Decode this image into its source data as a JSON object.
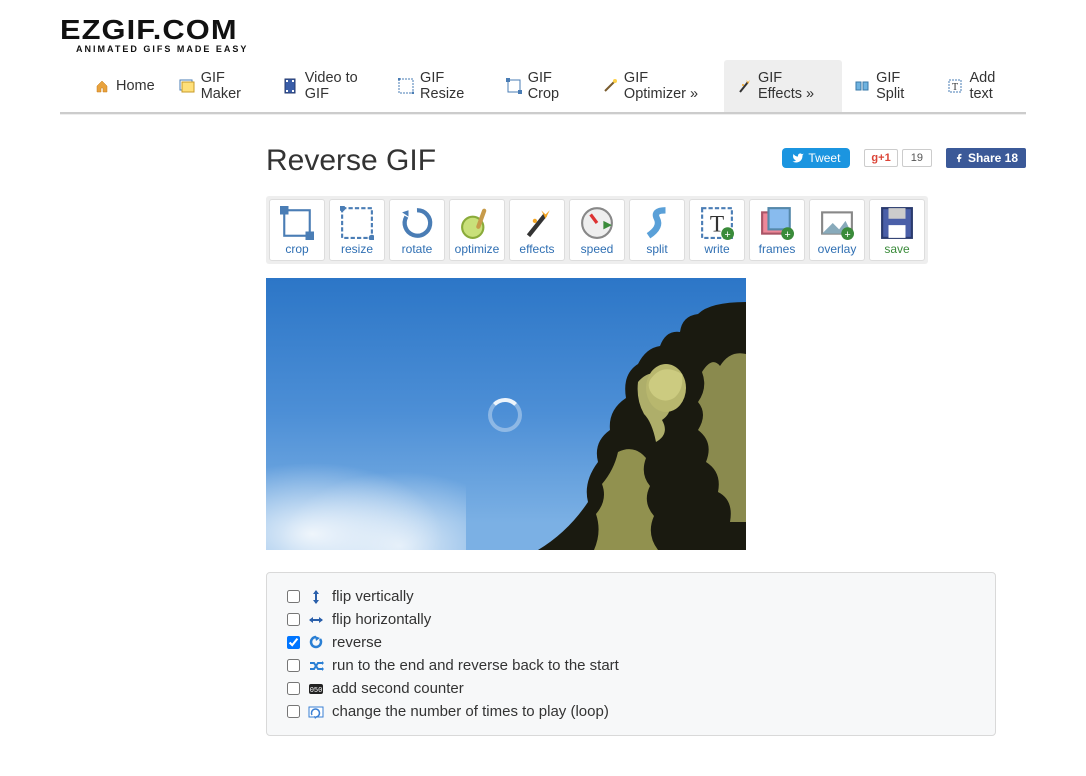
{
  "logo": {
    "main": "EZGIF.COM",
    "sub": "ANIMATED GIFS MADE EASY"
  },
  "nav": [
    {
      "label": "Home",
      "icon": "home"
    },
    {
      "label": "GIF Maker",
      "icon": "frames"
    },
    {
      "label": "Video to GIF",
      "icon": "film"
    },
    {
      "label": "GIF Resize",
      "icon": "resize"
    },
    {
      "label": "GIF Crop",
      "icon": "crop"
    },
    {
      "label": "GIF Optimizer »",
      "icon": "wand"
    },
    {
      "label": "GIF Effects »",
      "icon": "effects",
      "active": true
    },
    {
      "label": "GIF Split",
      "icon": "split"
    },
    {
      "label": "Add text",
      "icon": "text"
    }
  ],
  "title": "Reverse GIF",
  "social": {
    "tweet": "Tweet",
    "gplus": "+1",
    "gplus_count": "19",
    "fb": "Share 18"
  },
  "tools": [
    {
      "label": "crop",
      "icon": "crop"
    },
    {
      "label": "resize",
      "icon": "resize"
    },
    {
      "label": "rotate",
      "icon": "rotate"
    },
    {
      "label": "optimize",
      "icon": "optimize"
    },
    {
      "label": "effects",
      "icon": "effects"
    },
    {
      "label": "speed",
      "icon": "speed"
    },
    {
      "label": "split",
      "icon": "split"
    },
    {
      "label": "write",
      "icon": "write"
    },
    {
      "label": "frames",
      "icon": "frames"
    },
    {
      "label": "overlay",
      "icon": "overlay"
    },
    {
      "label": "save",
      "icon": "save",
      "cls": "save"
    }
  ],
  "options": [
    {
      "label": "flip vertically",
      "checked": false,
      "icon": "flipv"
    },
    {
      "label": "flip horizontally",
      "checked": false,
      "icon": "fliph"
    },
    {
      "label": "reverse",
      "checked": true,
      "icon": "reverse"
    },
    {
      "label": "run to the end and reverse back to the start",
      "checked": false,
      "icon": "shuffle"
    },
    {
      "label": "add second counter",
      "checked": false,
      "icon": "counter"
    },
    {
      "label": "change the number of times to play (loop)",
      "checked": false,
      "icon": "loop"
    }
  ]
}
